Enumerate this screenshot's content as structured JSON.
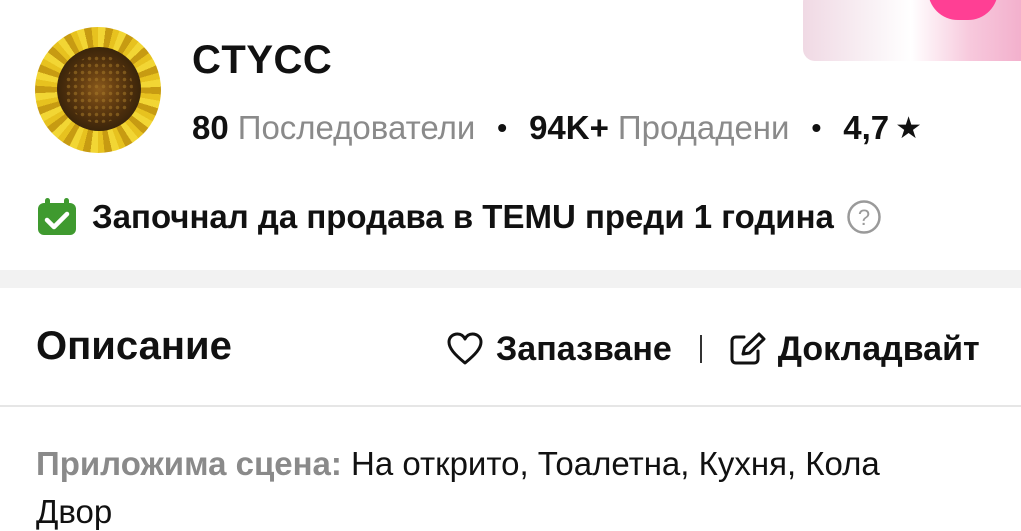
{
  "store": {
    "name": "CTYCC",
    "followers_count": "80",
    "followers_label": "Последователи",
    "sold_count": "94K+",
    "sold_label": "Продадени",
    "rating": "4,7",
    "rating_icon": "star-icon"
  },
  "since": {
    "text": "Започнал да продава в TEMU преди 1 година",
    "icon": "calendar-check-icon",
    "help_icon": "question-circle-icon",
    "icon_color": "#3f9a2f"
  },
  "description": {
    "title": "Описание",
    "save_label": "Запазване",
    "report_label": "Докладвайт",
    "scene_key": "Приложима сцена:",
    "scene_value_line1": " На открито, Тоалетна, Кухня, Кола",
    "scene_value_line2": "Двор"
  }
}
